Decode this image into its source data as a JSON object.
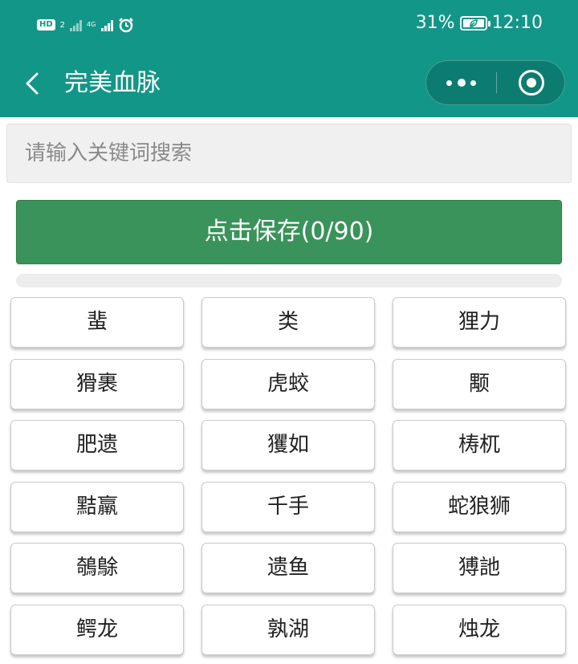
{
  "status_bar": {
    "hd": "HD",
    "sim": "2",
    "net": "4G",
    "battery_percent": "31%",
    "time": "12:10"
  },
  "nav": {
    "title": "完美血脉",
    "back_icon": "chevron-left-icon",
    "more_icon": "more-dots-icon",
    "close_icon": "target-circle-icon"
  },
  "search": {
    "placeholder": "请输入关键词搜索",
    "value": ""
  },
  "save_button": {
    "label": "点击保存(0/90)"
  },
  "progress": {
    "selected": 0,
    "total": 90
  },
  "items": [
    "蜚",
    "类",
    "狸力",
    "猾裹",
    "虎蛟",
    "颙",
    "肥遗",
    "玃如",
    "梼杌",
    "黠羸",
    "千手",
    "蛇狼狮",
    "鵸鵌",
    "遗鱼",
    "猼訑",
    "鳄龙",
    "孰湖",
    "烛龙"
  ],
  "colors": {
    "header": "#129688",
    "save_button": "#3a935a",
    "progress_track": "#ededed",
    "search_bg": "#f0f0f0"
  }
}
